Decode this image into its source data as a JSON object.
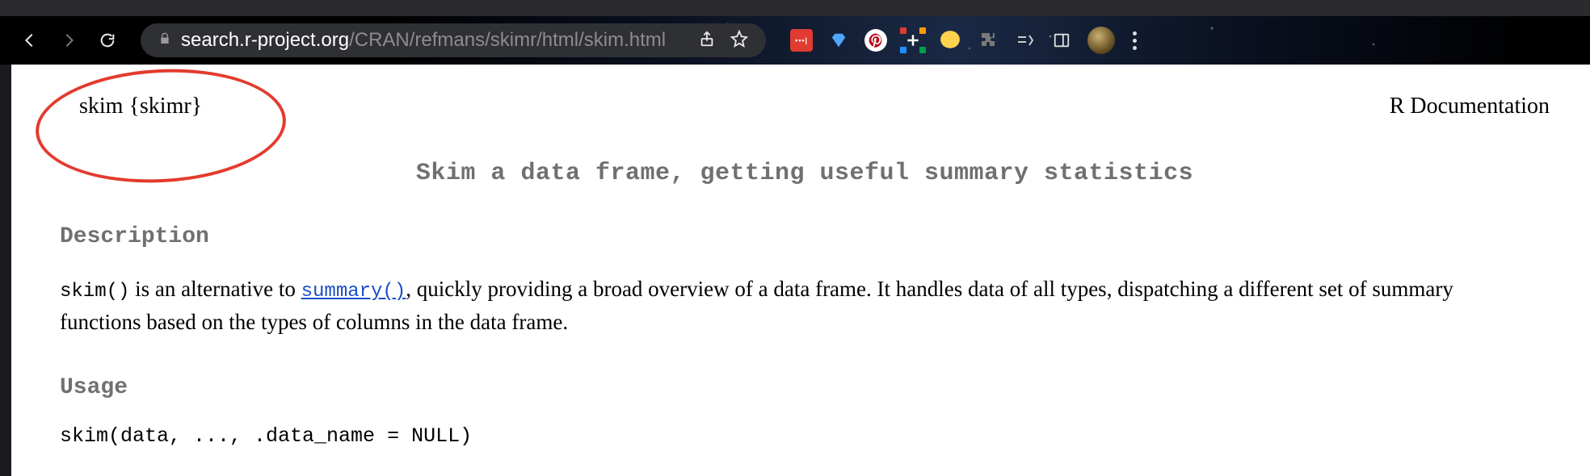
{
  "url": {
    "host": "search.r-project.org",
    "path": "/CRAN/refmans/skimr/html/skim.html"
  },
  "page": {
    "func_header": "skim {skimr}",
    "rdoc_label": "R Documentation",
    "title": "Skim a data frame, getting useful summary statistics",
    "section_description": "Description",
    "desc_pre": "skim()",
    "desc_mid1": " is an alternative to ",
    "desc_link": "summary()",
    "desc_mid2": ", quickly providing a broad overview of a data frame. It handles data of all types, dispatching a different set of summary functions based on the types of columns in the data frame.",
    "section_usage": "Usage",
    "usage_code": "skim(data, ..., .data_name = NULL)"
  },
  "annotation": {
    "color": "#e33b2e"
  }
}
